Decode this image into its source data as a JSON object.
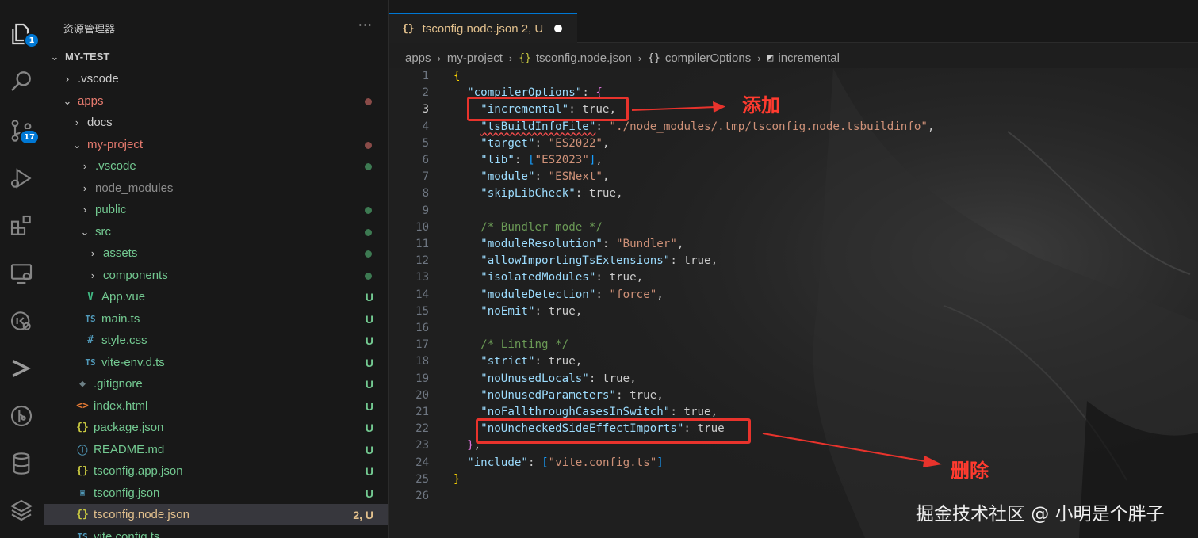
{
  "activity_bar": {
    "explorer_badge": "1",
    "scm_badge": "17"
  },
  "explorer": {
    "title": "资源管理器",
    "more": "···",
    "root": "MY-TEST",
    "rows": [
      {
        "name": ".vscode",
        "status": ""
      },
      {
        "name": "apps",
        "status": ""
      },
      {
        "name": "docs",
        "status": ""
      },
      {
        "name": "my-project",
        "status": ""
      },
      {
        "name": ".vscode",
        "status": ""
      },
      {
        "name": "node_modules",
        "status": ""
      },
      {
        "name": "public",
        "status": ""
      },
      {
        "name": "src",
        "status": ""
      },
      {
        "name": "assets",
        "status": ""
      },
      {
        "name": "components",
        "status": ""
      },
      {
        "name": "App.vue",
        "status": "U"
      },
      {
        "name": "main.ts",
        "status": "U"
      },
      {
        "name": "style.css",
        "status": "U"
      },
      {
        "name": "vite-env.d.ts",
        "status": "U"
      },
      {
        "name": ".gitignore",
        "status": "U"
      },
      {
        "name": "index.html",
        "status": "U"
      },
      {
        "name": "package.json",
        "status": "U"
      },
      {
        "name": "README.md",
        "status": "U"
      },
      {
        "name": "tsconfig.app.json",
        "status": "U"
      },
      {
        "name": "tsconfig.json",
        "status": "U"
      },
      {
        "name": "tsconfig.node.json",
        "status": "2, U"
      },
      {
        "name": "vite.config.ts",
        "status": ""
      }
    ]
  },
  "tab": {
    "icon": "{}",
    "name": "tsconfig.node.json",
    "status": "2, U"
  },
  "breadcrumb": {
    "items": [
      "apps",
      "my-project",
      "tsconfig.node.json",
      "compilerOptions",
      "incremental"
    ]
  },
  "editor": {
    "line_numbers": [
      "1",
      "2",
      "3",
      "4",
      "5",
      "6",
      "7",
      "8",
      "9",
      "10",
      "11",
      "12",
      "13",
      "14",
      "15",
      "16",
      "17",
      "18",
      "19",
      "20",
      "21",
      "22",
      "23",
      "24",
      "25",
      "26"
    ],
    "current_line": "3",
    "lines": [
      "{",
      "  \"compilerOptions\": {",
      "    \"incremental\": true,",
      "    \"tsBuildInfoFile\": \"./node_modules/.tmp/tsconfig.node.tsbuildinfo\",",
      "    \"target\": \"ES2022\",",
      "    \"lib\": [\"ES2023\"],",
      "    \"module\": \"ESNext\",",
      "    \"skipLibCheck\": true,",
      "",
      "    /* Bundler mode */",
      "    \"moduleResolution\": \"Bundler\",",
      "    \"allowImportingTsExtensions\": true,",
      "    \"isolatedModules\": true,",
      "    \"moduleDetection\": \"force\",",
      "    \"noEmit\": true,",
      "",
      "    /* Linting */",
      "    \"strict\": true,",
      "    \"noUnusedLocals\": true,",
      "    \"noUnusedParameters\": true,",
      "    \"noFallthroughCasesInSwitch\": true,",
      "    \"noUncheckedSideEffectImports\": true",
      "  },",
      "  \"include\": [\"vite.config.ts\"]",
      "}",
      ""
    ]
  },
  "annotations": {
    "add_label": "添加",
    "delete_label": "删除",
    "color": "#e8332c"
  },
  "watermark": "掘金技术社区 @ 小明是个胖子"
}
